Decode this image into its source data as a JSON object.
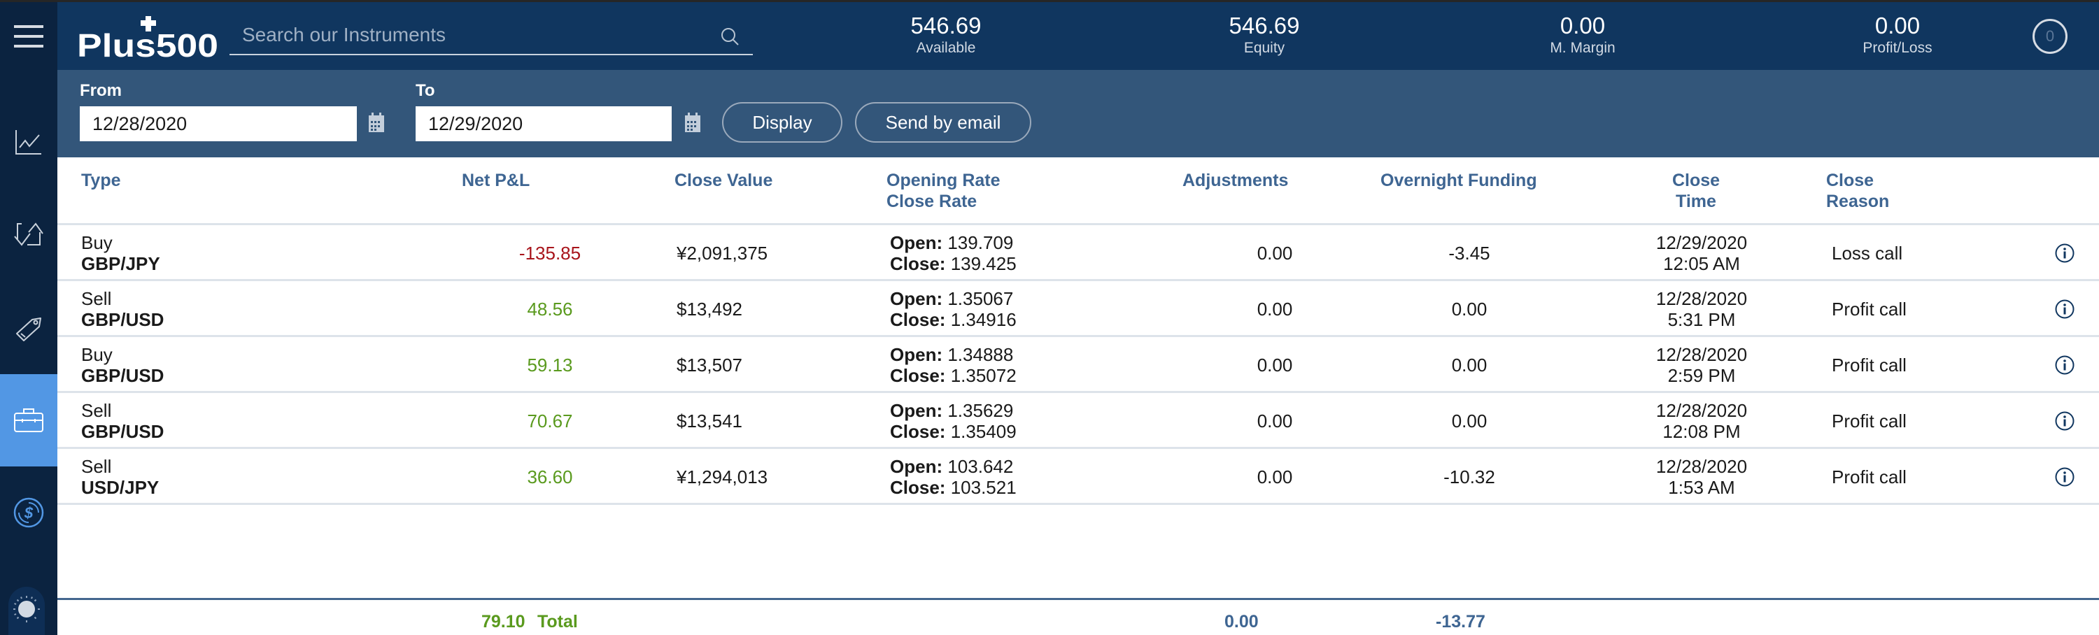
{
  "header": {
    "logo_text": "Plus500",
    "search_placeholder": "Search our Instruments",
    "search_value": "",
    "stats": [
      {
        "value": "546.69",
        "label": "Available"
      },
      {
        "value": "546.69",
        "label": "Equity"
      },
      {
        "value": "0.00",
        "label": "M. Margin"
      },
      {
        "value": "0.00",
        "label": "Profit/Loss"
      }
    ],
    "notifications_count": "0"
  },
  "sidebar": {
    "items": [
      {
        "icon": "chart-line-icon",
        "label": "Charts"
      },
      {
        "icon": "buy-sell-arrows-icon",
        "label": "Trade"
      },
      {
        "icon": "price-tag-icon",
        "label": "Orders"
      },
      {
        "icon": "briefcase-icon",
        "label": "Closed Positions",
        "active": true
      },
      {
        "icon": "dollar-coin-icon",
        "label": "Funds"
      }
    ],
    "theme_icon": "sun-icon"
  },
  "filters": {
    "from_label": "From",
    "from_value": "12/28/2020",
    "to_label": "To",
    "to_value": "12/29/2020",
    "display_label": "Display",
    "email_label": "Send by email"
  },
  "table": {
    "headers": {
      "type": "Type",
      "net_pl": "Net P&L",
      "close_value": "Close Value",
      "rates_1": "Opening Rate",
      "rates_2": "Close Rate",
      "adjustments": "Adjustments",
      "overnight": "Overnight Funding",
      "close_time_1": "Close",
      "close_time_2": "Time",
      "close_reason_1": "Close",
      "close_reason_2": "Reason"
    },
    "open_prefix": "Open:",
    "close_prefix": "Close:",
    "rows": [
      {
        "side": "Buy",
        "instrument": "GBP/JPY",
        "net_pl": "-135.85",
        "pl_sign": "neg",
        "close_value": "¥2,091,375",
        "open_rate": "139.709",
        "close_rate": "139.425",
        "adjustments": "0.00",
        "overnight": "-3.45",
        "close_date": "12/29/2020",
        "close_time": "12:05 AM",
        "reason": "Loss call"
      },
      {
        "side": "Sell",
        "instrument": "GBP/USD",
        "net_pl": "48.56",
        "pl_sign": "pos",
        "close_value": "$13,492",
        "open_rate": "1.35067",
        "close_rate": "1.34916",
        "adjustments": "0.00",
        "overnight": "0.00",
        "close_date": "12/28/2020",
        "close_time": "5:31 PM",
        "reason": "Profit call"
      },
      {
        "side": "Buy",
        "instrument": "GBP/USD",
        "net_pl": "59.13",
        "pl_sign": "pos",
        "close_value": "$13,507",
        "open_rate": "1.34888",
        "close_rate": "1.35072",
        "adjustments": "0.00",
        "overnight": "0.00",
        "close_date": "12/28/2020",
        "close_time": "2:59 PM",
        "reason": "Profit call"
      },
      {
        "side": "Sell",
        "instrument": "GBP/USD",
        "net_pl": "70.67",
        "pl_sign": "pos",
        "close_value": "$13,541",
        "open_rate": "1.35629",
        "close_rate": "1.35409",
        "adjustments": "0.00",
        "overnight": "0.00",
        "close_date": "12/28/2020",
        "close_time": "12:08 PM",
        "reason": "Profit call"
      },
      {
        "side": "Sell",
        "instrument": "USD/JPY",
        "net_pl": "36.60",
        "pl_sign": "pos",
        "close_value": "¥1,294,013",
        "open_rate": "103.642",
        "close_rate": "103.521",
        "adjustments": "0.00",
        "overnight": "-10.32",
        "close_date": "12/28/2020",
        "close_time": "1:53 AM",
        "reason": "Profit call"
      }
    ],
    "totals": {
      "net_pl": "79.10",
      "label": "Total",
      "adjustments": "0.00",
      "overnight": "-13.77"
    }
  },
  "colors": {
    "header_bg": "#10365f",
    "filterbar_bg": "#33567a",
    "sidebar_bg": "#0b2340",
    "sidebar_active": "#5297e4",
    "column_header": "#3e6592",
    "profit": "#5a9a1e",
    "loss": "#a8141b"
  }
}
